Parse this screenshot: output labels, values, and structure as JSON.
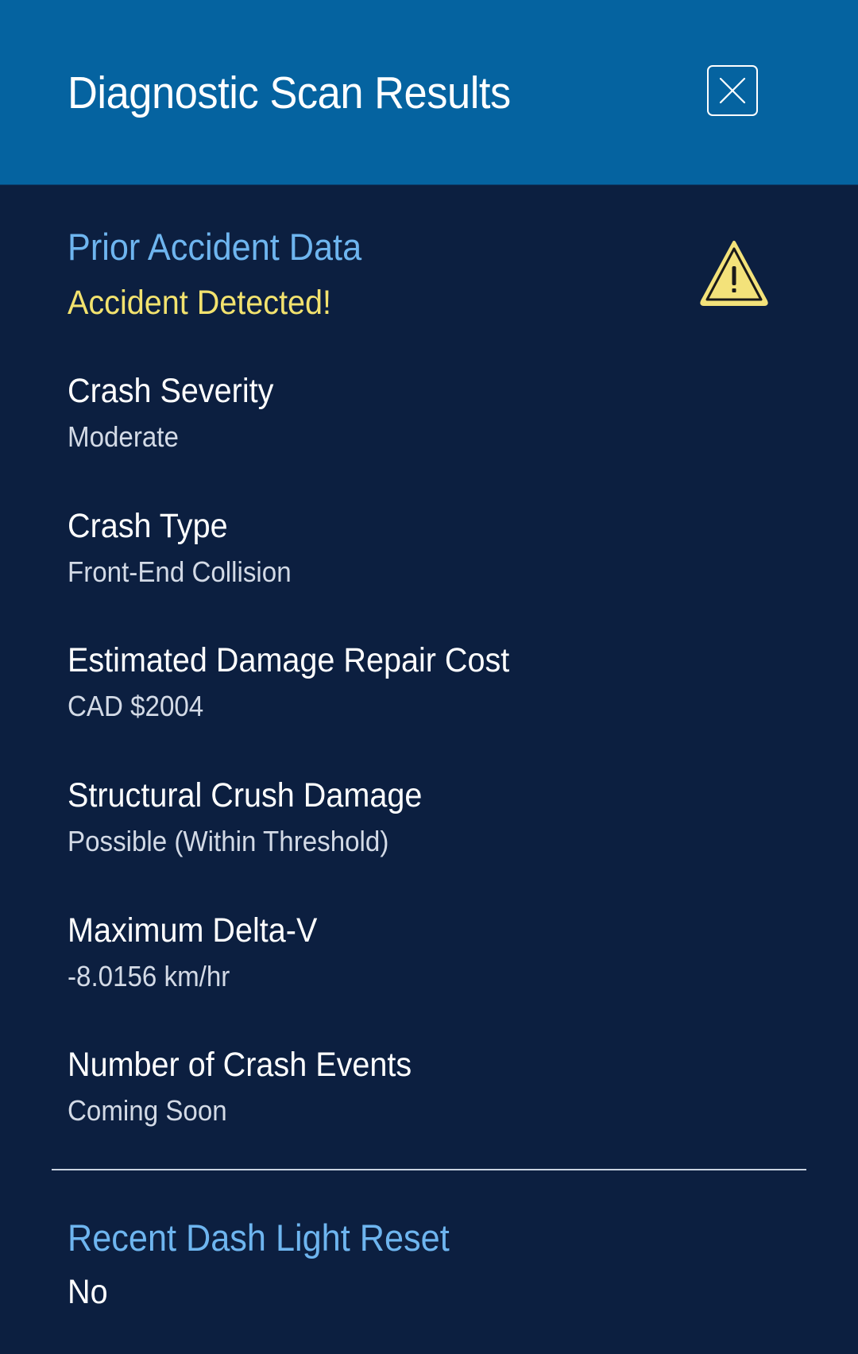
{
  "header": {
    "title": "Diagnostic Scan Results",
    "close_icon": "close-icon"
  },
  "colors": {
    "header_bg": "#0563a0",
    "page_bg": "#0c1f40",
    "section_heading": "#6eb5ef",
    "alert": "#f2e26e",
    "warning_fill": "#f3e27a"
  },
  "accident_section": {
    "heading": "Prior Accident Data",
    "status": "Accident Detected!",
    "status_icon": "warning-triangle-icon",
    "items": [
      {
        "label": "Crash Severity",
        "value": "Moderate"
      },
      {
        "label": "Crash Type",
        "value": "Front-End Collision"
      },
      {
        "label": "Estimated Damage Repair Cost",
        "value": "CAD $2004"
      },
      {
        "label": "Structural Crush Damage",
        "value": "Possible (Within Threshold)"
      },
      {
        "label": "Maximum Delta-V",
        "value": "-8.0156 km/hr"
      },
      {
        "label": "Number of Crash Events",
        "value": "Coming Soon"
      }
    ]
  },
  "dash_light_section": {
    "heading": "Recent Dash Light Reset",
    "value": "No"
  }
}
